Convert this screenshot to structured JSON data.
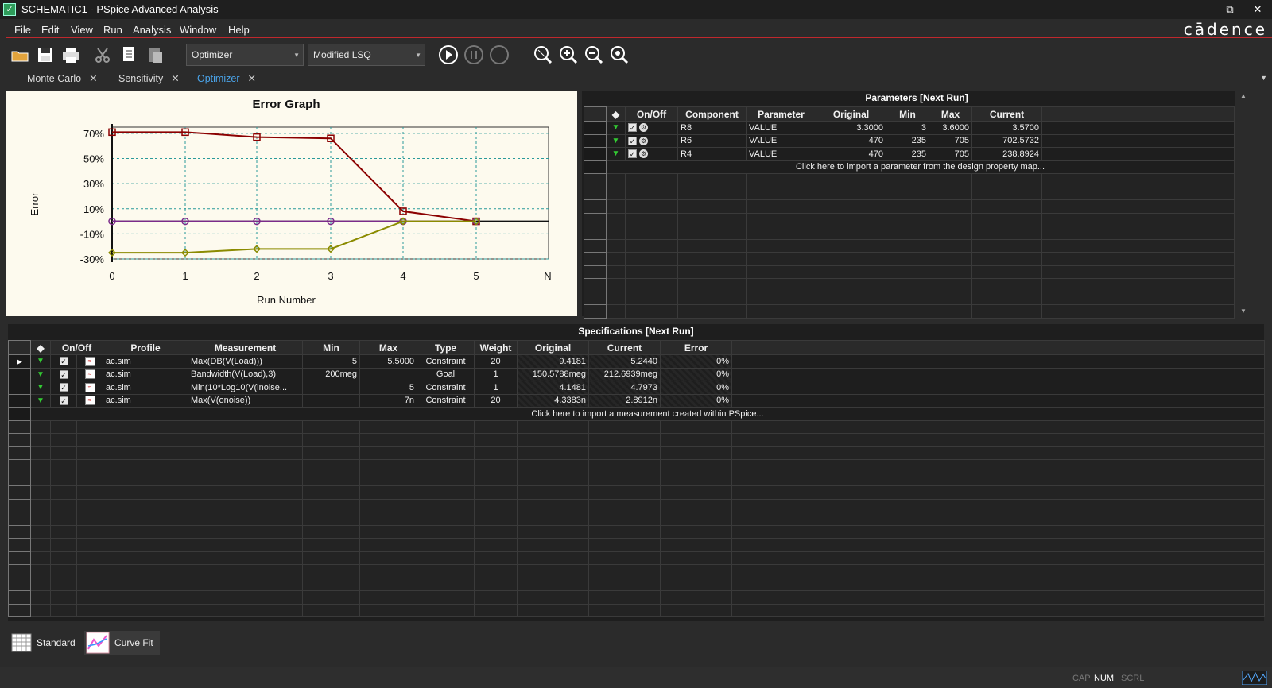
{
  "window": {
    "title": "SCHEMATIC1 - PSpice Advanced Analysis",
    "minimize": "–",
    "restore": "⧉",
    "close": "✕"
  },
  "menu": [
    "File",
    "Edit",
    "View",
    "Run",
    "Analysis",
    "Window",
    "Help"
  ],
  "brand": "cādence",
  "toolbar": {
    "engine": "Optimizer",
    "algorithm": "Modified LSQ"
  },
  "tabs": [
    {
      "label": "Monte Carlo"
    },
    {
      "label": "Sensitivity"
    },
    {
      "label": "Optimizer"
    }
  ],
  "chart_data": {
    "type": "line",
    "title": "Error Graph",
    "xlabel": "Run Number",
    "ylabel": "Error",
    "categories": [
      "0",
      "1",
      "2",
      "3",
      "4",
      "5",
      "N"
    ],
    "yticks": [
      "70%",
      "50%",
      "30%",
      "10%",
      "-10%",
      "-30%"
    ],
    "ylim": [
      -30,
      75
    ],
    "grid": true,
    "series": [
      {
        "color": "#8b0000",
        "values": [
          71,
          71,
          67,
          66,
          8,
          0
        ]
      },
      {
        "color": "#7b2b8b",
        "values": [
          0,
          0,
          0,
          0,
          0,
          0
        ]
      },
      {
        "color": "#8b8b00",
        "values": [
          -25,
          -25,
          -22,
          -22,
          0,
          0
        ]
      }
    ]
  },
  "params": {
    "title": "Parameters [Next Run]",
    "headers": [
      "◆",
      "On/Off",
      "Component",
      "Parameter",
      "Original",
      "Min",
      "Max",
      "Current"
    ],
    "rows": [
      {
        "component": "R8",
        "parameter": "VALUE",
        "original": "3.3000",
        "min": "3",
        "max": "3.6000",
        "current": "3.5700"
      },
      {
        "component": "R6",
        "parameter": "VALUE",
        "original": "470",
        "min": "235",
        "max": "705",
        "current": "702.5732"
      },
      {
        "component": "R4",
        "parameter": "VALUE",
        "original": "470",
        "min": "235",
        "max": "705",
        "current": "238.8924"
      }
    ],
    "import_text": "Click here to import a parameter from the design property map..."
  },
  "specs": {
    "title": "Specifications [Next Run]",
    "headers": [
      "◆",
      "On/Off",
      "Profile",
      "Measurement",
      "Min",
      "Max",
      "Type",
      "Weight",
      "Original",
      "Current",
      "Error"
    ],
    "rows": [
      {
        "profile": "ac.sim",
        "measurement": "Max(DB(V(Load)))",
        "min": "5",
        "max": "5.5000",
        "type": "Constraint",
        "weight": "20",
        "original": "9.4181",
        "current": "5.2440",
        "error": "0%"
      },
      {
        "profile": "ac.sim",
        "measurement": "Bandwidth(V(Load),3)",
        "min": "200meg",
        "max": "",
        "type": "Goal",
        "weight": "1",
        "original": "150.5788meg",
        "current": "212.6939meg",
        "error": "0%"
      },
      {
        "profile": "ac.sim",
        "measurement": "Min(10*Log10(V(inoise...",
        "min": "",
        "max": "5",
        "type": "Constraint",
        "weight": "1",
        "original": "4.1481",
        "current": "4.7973",
        "error": "0%"
      },
      {
        "profile": "ac.sim",
        "measurement": "Max(V(onoise))",
        "min": "",
        "max": "7n",
        "type": "Constraint",
        "weight": "20",
        "original": "4.3383n",
        "current": "2.8912n",
        "error": "0%"
      }
    ],
    "import_text": "Click here to import a measurement created within PSpice..."
  },
  "bottom_tabs": [
    {
      "label": "Standard"
    },
    {
      "label": "Curve Fit"
    }
  ],
  "status": {
    "cap": "CAP",
    "num": "NUM",
    "scrl": "SCRL"
  }
}
